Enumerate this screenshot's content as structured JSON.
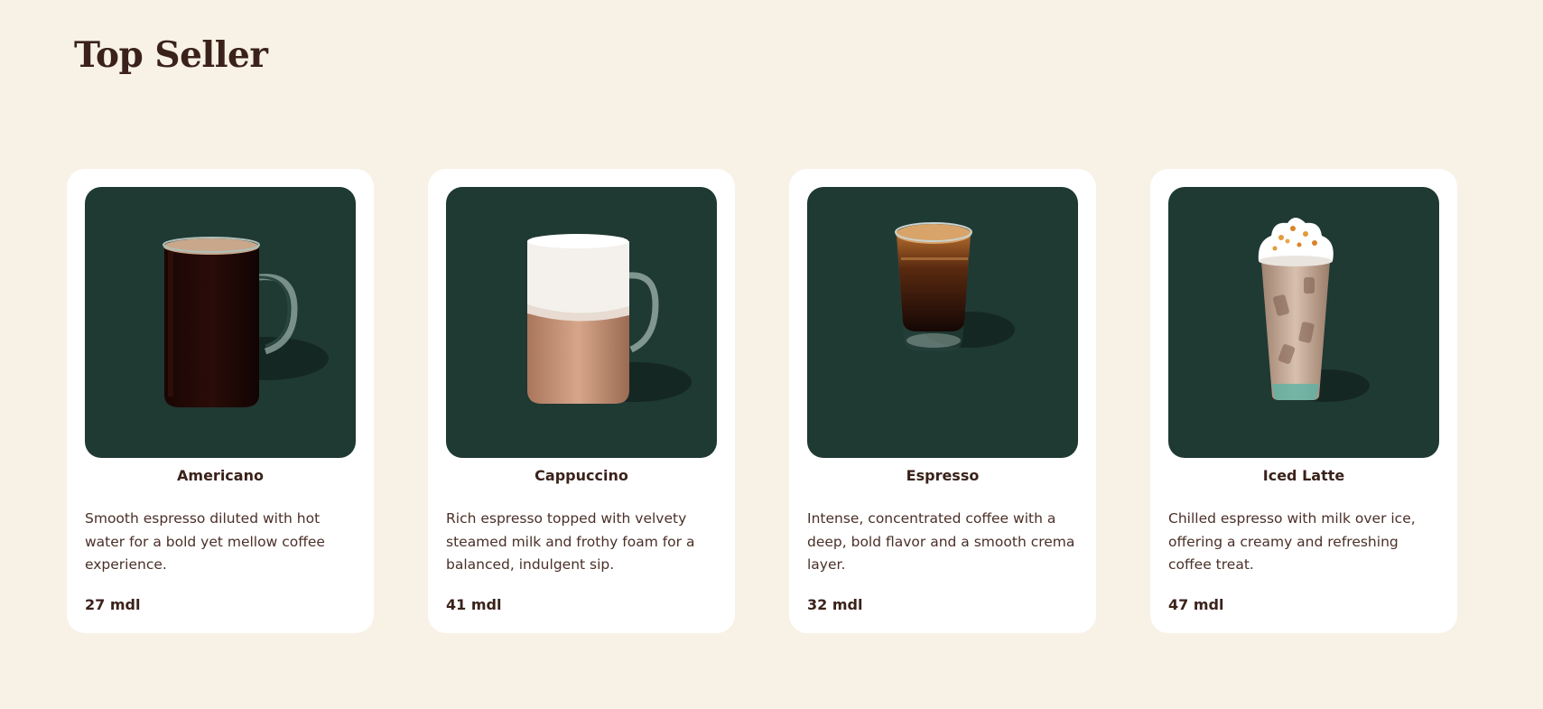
{
  "section": {
    "title": "Top Seller"
  },
  "products": [
    {
      "name": "Americano",
      "description": "Smooth espresso diluted with hot water for a bold yet mellow coffee experience.",
      "price": "27 mdl",
      "image_icon": "americano-mug-icon"
    },
    {
      "name": "Cappuccino",
      "description": "Rich espresso topped with velvety steamed milk and frothy foam for a balanced, indulgent sip.",
      "price": "41 mdl",
      "image_icon": "cappuccino-mug-icon"
    },
    {
      "name": "Espresso",
      "description": "Intense, concentrated coffee with a deep, bold flavor and a smooth crema layer.",
      "price": "32 mdl",
      "image_icon": "espresso-shot-icon"
    },
    {
      "name": "Iced Latte",
      "description": "Chilled espresso with milk over ice, offering a creamy and refreshing coffee treat.",
      "price": "47 mdl",
      "image_icon": "iced-latte-cup-icon"
    }
  ],
  "colors": {
    "page_background": "#f8f1e6",
    "card_background": "#ffffff",
    "image_background": "#1f3933",
    "text_primary": "#3a221a"
  }
}
